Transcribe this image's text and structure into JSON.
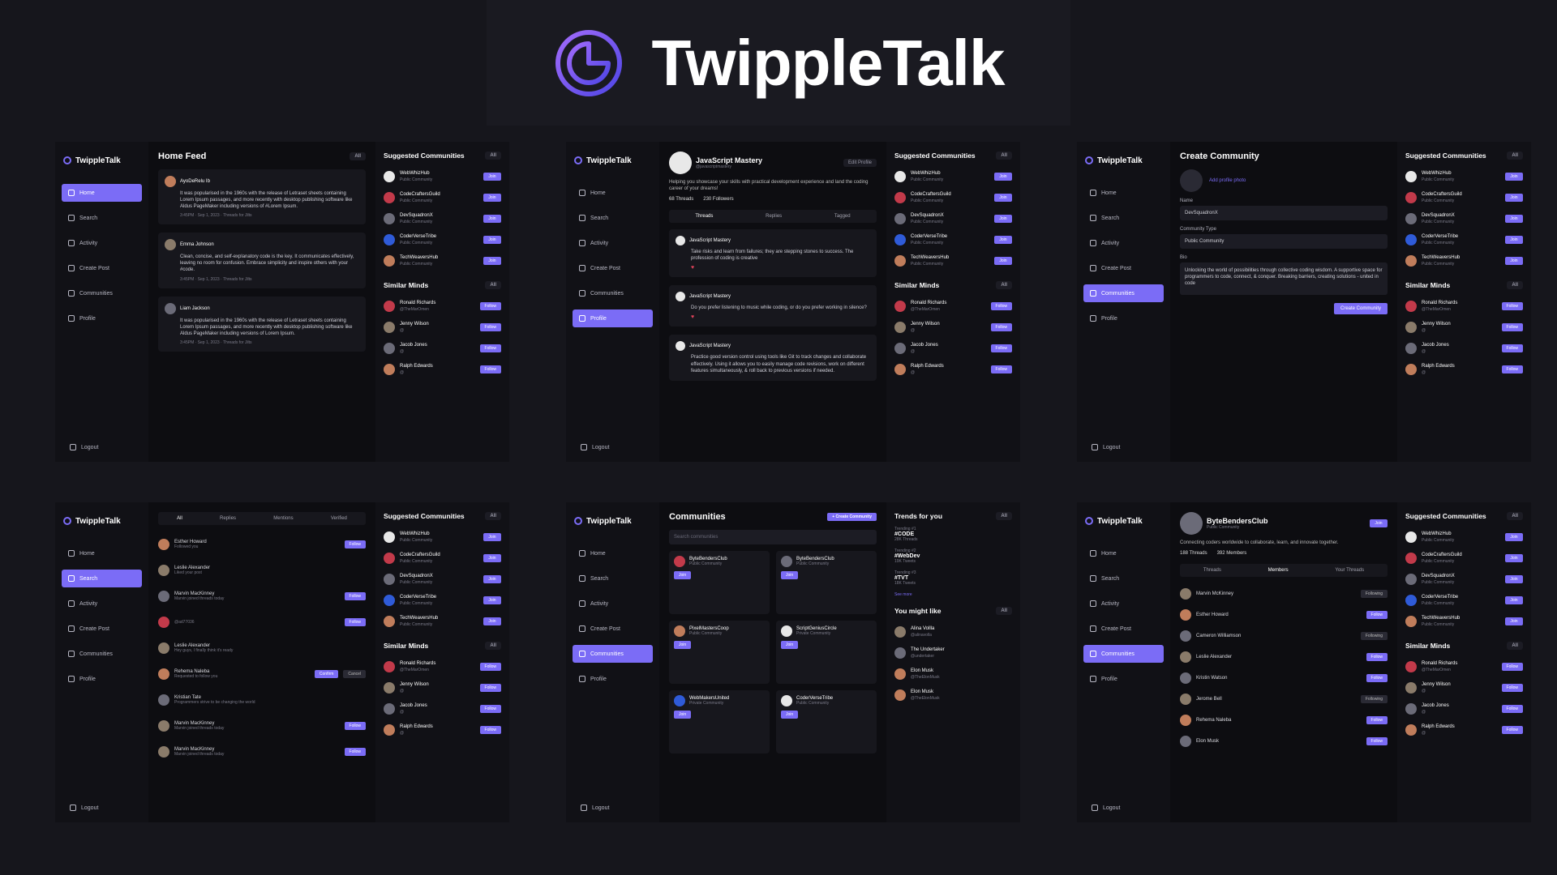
{
  "brand": {
    "name": "TwippleTalk",
    "accent": "#7b6cf6",
    "logo_icon": "twippletalk-logo-icon"
  },
  "nav": {
    "items": [
      "Home",
      "Search",
      "Activity",
      "Create Post",
      "Communities",
      "Profile"
    ],
    "logout": "Logout"
  },
  "sidebar_logo": "TwippleTalk",
  "suggested": {
    "title": "Suggested Communities",
    "filter": "All",
    "items": [
      {
        "name": "WebWhizHub",
        "sub": "Public Community",
        "action": "Join"
      },
      {
        "name": "CodeCraftersGuild",
        "sub": "Public Community",
        "action": "Join"
      },
      {
        "name": "DevSquadronX",
        "sub": "Public Community",
        "action": "Join"
      },
      {
        "name": "CoderVerseTribe",
        "sub": "Public Community",
        "action": "Join"
      },
      {
        "name": "TechWeaversHub",
        "sub": "Public Community",
        "action": "Join"
      }
    ]
  },
  "similar": {
    "title": "Similar Minds",
    "filter": "All",
    "items": [
      {
        "name": "Ronald Richards",
        "sub": "@TheMarOmen",
        "action": "Follow"
      },
      {
        "name": "Jenny Wilson",
        "sub": "@",
        "action": "Follow"
      },
      {
        "name": "Jacob Jones",
        "sub": "@",
        "action": "Follow"
      },
      {
        "name": "Ralph Edwards",
        "sub": "@",
        "action": "Follow"
      }
    ]
  },
  "p1": {
    "title": "Home Feed",
    "filter": "All",
    "posts": [
      {
        "author": "AyoDeRelu Ib",
        "body": "It was popularised in the 1960s with the release of Letraset sheets containing Lorem Ipsum passages, and more recently with desktop publishing software like Aldus PageMaker including versions of #Lorem Ipsum.",
        "meta": "3:45PM · Sep 1, 2023 · Threads for Jilts"
      },
      {
        "author": "Emma Johnson",
        "body": "Clean, concise, and self-explanatory code is the key. It communicates effectively, leaving no room for confusion. Embrace simplicity and inspire others with your #code.",
        "meta": "3:45PM · Sep 1, 2023 · Threads for Jilts"
      },
      {
        "author": "Liam Jackson",
        "body": "It was popularised in the 1960s with the release of Letraset sheets containing Lorem Ipsum passages, and more recently with desktop publishing software like Aldus PageMaker including versions of Lorem Ipsum.",
        "meta": "3:45PM · Sep 1, 2023 · Threads for Jilts"
      }
    ]
  },
  "p2": {
    "name": "JavaScript Mastery",
    "handle": "@javascriptmastery",
    "edit": "Edit Profile",
    "bio": "Helping you showcase your skills with practical development experience and land the coding career of your dreams!",
    "threads": "68 Threads",
    "followers": "230 Followers",
    "tabs": [
      "Threads",
      "Replies",
      "Tagged"
    ],
    "posts": [
      {
        "author": "JavaScript Mastery",
        "body": "Take risks and learn from failures; they are stepping stones to success. The profession of coding is creative"
      },
      {
        "author": "JavaScript Mastery",
        "body": "Do you prefer listening to music while coding, or do you prefer working in silence?"
      },
      {
        "author": "JavaScript Mastery",
        "body": "Practice good version control using tools like Git to track changes and collaborate effectively. Using it allows you to easily manage code revisions, work on different features simultaneously, & roll back to previous versions if needed."
      }
    ]
  },
  "p3": {
    "title": "Create Community",
    "add_photo": "Add profile photo",
    "name_label": "Name",
    "name_value": "DevSquadronX",
    "type_label": "Community Type",
    "type_value": "Public Community",
    "bio_label": "Bio",
    "bio_value": "Unlocking the world of possibilities through collective coding wisdom. A supportive space for programmers to code, connect, & conquer. Breaking barriers, creating solutions - united in code",
    "submit": "Create Community"
  },
  "p4": {
    "tabs": [
      "All",
      "Replies",
      "Mentions",
      "Verified"
    ],
    "rows": [
      {
        "name": "Esther Howard",
        "sub": "Followed you",
        "action": "Follow"
      },
      {
        "name": "Leslie Alexander",
        "sub": "Liked your post",
        "action": ""
      },
      {
        "name": "Marvin MacKinney",
        "sub": "Marvin joined threads today",
        "action": "Follow"
      },
      {
        "name": "",
        "sub": "@ad77036",
        "action": "Follow"
      },
      {
        "name": "Leslie Alexander",
        "sub": "Hey guys, I finally think it's ready",
        "action": ""
      },
      {
        "name": "Rehema Naleba",
        "sub": "Requested to follow you",
        "action": "Confirm"
      },
      {
        "name": "Kristian Tate",
        "sub": "Programmers strive to be changing the world",
        "action": ""
      },
      {
        "name": "Marvin MacKinney",
        "sub": "Marvin joined threads today",
        "action": "Follow"
      },
      {
        "name": "Marvin MacKinney",
        "sub": "Marvin joined threads today",
        "action": "Follow"
      }
    ],
    "delete": "Cancel"
  },
  "p5": {
    "title": "Communities",
    "create": "+ Create Community",
    "search_placeholder": "Search communities",
    "cards": [
      {
        "name": "ByteBendersClub",
        "sub": "Public Community",
        "action": "Join"
      },
      {
        "name": "ByteBendersClub",
        "sub": "Public Community",
        "action": "Join"
      },
      {
        "name": "PixelMastersCoop",
        "sub": "Public Community",
        "action": "Join"
      },
      {
        "name": "ScriptGeniusCircle",
        "sub": "Private Community",
        "action": "Join"
      },
      {
        "name": "WebMakersUnited",
        "sub": "Private Community",
        "action": "Join"
      },
      {
        "name": "CoderVerseTribe",
        "sub": "Public Community",
        "action": "Join"
      }
    ],
    "trends_title": "Trends for you",
    "trends_filter": "All",
    "trends": [
      {
        "label": "Trending #1",
        "tag": "#CODE",
        "count": "28K Threads"
      },
      {
        "label": "Trending #2",
        "tag": "#WebDev",
        "count": "19K Tweets"
      },
      {
        "label": "Trending #3",
        "tag": "#TVT",
        "count": "18K Tweets"
      }
    ],
    "see_more": "See more",
    "might_like_title": "You might like",
    "might_like": [
      {
        "name": "Alina Vollla",
        "sub": "@alinavolla"
      },
      {
        "name": "The Undertaker",
        "sub": "@undertaker"
      },
      {
        "name": "Elon Musk",
        "sub": "@TheElonMusk"
      },
      {
        "name": "Elon Musk",
        "sub": "@TheElonMusk"
      }
    ]
  },
  "p6": {
    "name": "ByteBendersClub",
    "sub": "Public Community",
    "join": "Join",
    "bio": "Connecting coders worldwide to collaborate, learn, and innovate together.",
    "threads": "188 Threads",
    "members": "392 Members",
    "tabs": [
      "Threads",
      "Members",
      "Your Threads"
    ],
    "rows": [
      {
        "name": "Marvin McKinney",
        "action": "Following"
      },
      {
        "name": "Esther Howard",
        "action": "Follow"
      },
      {
        "name": "Cameron Williamson",
        "action": "Following"
      },
      {
        "name": "Leslie Alexander",
        "action": "Follow"
      },
      {
        "name": "Kristin Watson",
        "action": "Follow"
      },
      {
        "name": "Jerome Bell",
        "action": "Following"
      },
      {
        "name": "Rehema Naleba",
        "action": "Follow"
      },
      {
        "name": "Elon Musk",
        "action": "Follow"
      }
    ]
  }
}
